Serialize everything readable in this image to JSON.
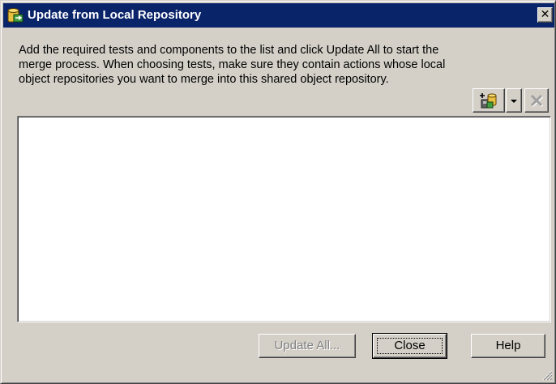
{
  "window": {
    "title": "Update from Local Repository",
    "close_glyph": "✕"
  },
  "instructions": "Add the required tests and components to the list and click Update All to start the merge process. When choosing tests, make sure they contain actions whose local object repositories you want to merge into this shared object repository.",
  "toolbar": {
    "add_icon": "add-tests-icon",
    "dropdown_icon": "dropdown-arrow-icon",
    "remove_icon": "remove-icon"
  },
  "list": {
    "items": []
  },
  "buttons": {
    "update_all": "Update All...",
    "close": "Close",
    "help": "Help"
  },
  "colors": {
    "titlebar": "#0a246a",
    "face": "#d4d0c8",
    "disabled_text": "#808080"
  }
}
